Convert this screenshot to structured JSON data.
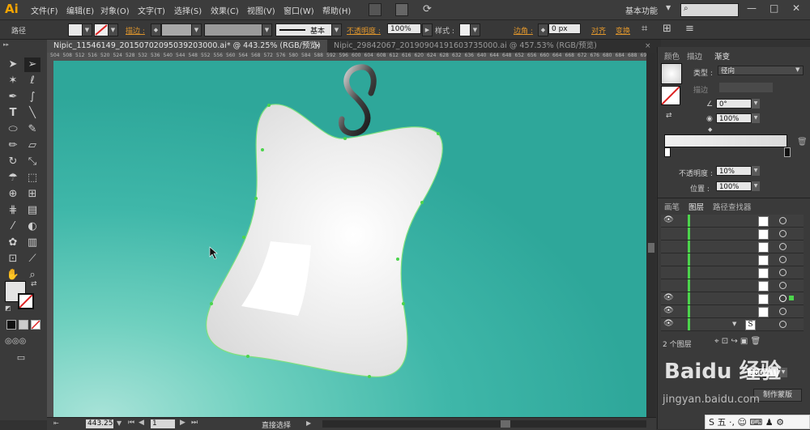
{
  "app": {
    "logo": "Ai"
  },
  "menu": [
    "文件(F)",
    "编辑(E)",
    "对象(O)",
    "文字(T)",
    "选择(S)",
    "效果(C)",
    "视图(V)",
    "窗口(W)",
    "帮助(H)"
  ],
  "workspace": {
    "label": "基本功能"
  },
  "control_bar": {
    "object_type": "路径",
    "stroke_label": "描边 :",
    "stroke_style": "基本",
    "opacity_label": "不透明度 :",
    "opacity_value": "100%",
    "style_label": "样式 :",
    "corner_label": "边角 :",
    "corner_value": "0 px",
    "align_label": "对齐",
    "transform_label": "变换"
  },
  "tabs": [
    {
      "label": "Nipic_11546149_20150702095039203000.ai* @ 443.25% (RGB/预览)",
      "close": "×"
    },
    {
      "label": "Nipic_29842067_20190904191603735000.ai @ 457.53% (RGB/预览)",
      "close": "×"
    }
  ],
  "ruler_ticks": [
    "504",
    "508",
    "512",
    "516",
    "520",
    "524",
    "528",
    "532",
    "536",
    "540",
    "544",
    "548",
    "552",
    "556",
    "560",
    "564",
    "568",
    "572",
    "576",
    "580",
    "584",
    "588",
    "592",
    "596",
    "600",
    "604",
    "608",
    "612",
    "616",
    "620",
    "624",
    "628",
    "632",
    "636",
    "640",
    "644",
    "648",
    "652",
    "656",
    "660",
    "664",
    "668",
    "672",
    "676",
    "680",
    "684",
    "688",
    "692"
  ],
  "canvas": {
    "hook_glyph": "S"
  },
  "status": {
    "zoom": "443.25",
    "page": "1",
    "tool": "直接选择"
  },
  "gradient_panel": {
    "tabs": [
      "颜色",
      "描边",
      "渐变"
    ],
    "type_label": "类型 :",
    "type_value": "径向",
    "stroke_label": "描边",
    "angle_value": "0°",
    "aspect_value": "100%",
    "opacity_label": "不透明度 :",
    "opacity_value": "10%",
    "location_label": "位置 :",
    "location_value": "100%"
  },
  "layers_panel": {
    "tabs": [
      "画笔",
      "图层",
      "路径查找器"
    ],
    "count_label": "2 个图层",
    "thumb_glyph": "S"
  },
  "bottom_panel": {
    "opacity_value": "100%",
    "mask_button": "制作蒙版"
  },
  "watermark": {
    "line1": "Baidu 经验",
    "line2": "jingyan.baidu.com"
  },
  "ime": {
    "label": "S 五 ·, ☺ ⌨ ♟ ⚙"
  },
  "colors": {
    "canvas_teal": "#3fb7a9",
    "accent_orange": "#e0962c",
    "selection_green": "#4cd44c"
  }
}
